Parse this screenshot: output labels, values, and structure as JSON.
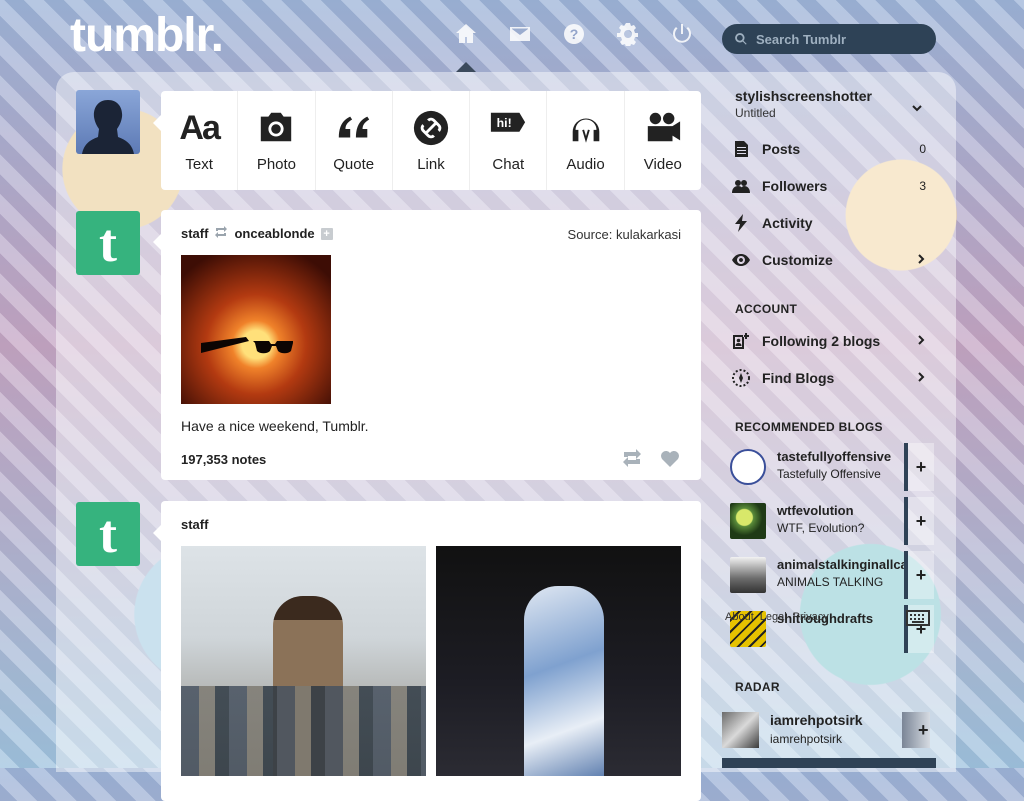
{
  "header": {
    "logo": "tumblr.",
    "nav_icons": [
      "home-icon",
      "inbox-icon",
      "help-icon",
      "settings-icon",
      "logout-icon"
    ],
    "search_placeholder": "Search Tumblr"
  },
  "composer": {
    "buttons": [
      {
        "label": "Text",
        "icon": "text-icon"
      },
      {
        "label": "Photo",
        "icon": "camera-icon"
      },
      {
        "label": "Quote",
        "icon": "quote-icon"
      },
      {
        "label": "Link",
        "icon": "link-icon"
      },
      {
        "label": "Chat",
        "icon": "chat-icon"
      },
      {
        "label": "Audio",
        "icon": "headphones-icon"
      },
      {
        "label": "Video",
        "icon": "video-camera-icon"
      }
    ],
    "text_glyph": "Aa",
    "chat_glyph": "hi!"
  },
  "posts": [
    {
      "author": "staff",
      "reblogged_from": "onceablonde",
      "source_label": "Source:",
      "source_name": "kulakarkasi",
      "caption": "Have a nice weekend, Tumblr.",
      "notes": "197,353 notes"
    },
    {
      "author": "staff"
    }
  ],
  "avatar_glyph": "t",
  "sidebar": {
    "blog_name": "stylishscreenshotter",
    "blog_title": "Untitled",
    "items": [
      {
        "label": "Posts",
        "count": "0",
        "icon": "posts-icon"
      },
      {
        "label": "Followers",
        "count": "3",
        "icon": "followers-icon"
      },
      {
        "label": "Activity",
        "count": "",
        "icon": "lightning-icon"
      },
      {
        "label": "Customize",
        "count": "",
        "icon": "eye-icon"
      }
    ],
    "account_title": "ACCOUNT",
    "account_items": [
      {
        "label": "Following 2 blogs",
        "icon": "following-icon"
      },
      {
        "label": "Find Blogs",
        "icon": "compass-icon"
      }
    ],
    "recommended_title": "RECOMMENDED BLOGS",
    "recommended": [
      {
        "name": "tastefullyoffensive",
        "title": "Tastefully Offensive",
        "color": "#3a4f9a"
      },
      {
        "name": "wtfevolution",
        "title": "WTF, Evolution?",
        "color": "#5a8c3a"
      },
      {
        "name": "animalstalkinginallcaps",
        "title": "ANIMALS TALKING",
        "color": "#4a4a4a"
      },
      {
        "name": "shitroughdrafts",
        "title": "",
        "color": "#e6c200"
      }
    ],
    "footer_links": [
      "About",
      "Legal",
      "Privacy"
    ],
    "radar_title": "RADAR",
    "radar_item": {
      "name": "iamrehpotsirk",
      "title": "iamrehpotsirk"
    }
  }
}
